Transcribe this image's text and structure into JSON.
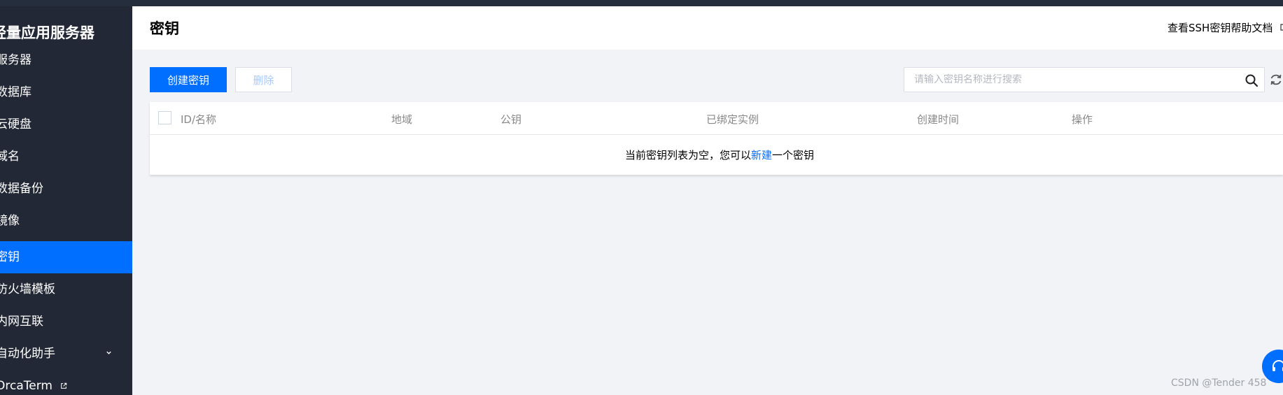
{
  "sidebar": {
    "brand": "轻量应用服务器",
    "items": [
      {
        "label": "服务器"
      },
      {
        "label": "数据库"
      },
      {
        "label": "云硬盘"
      },
      {
        "label": "域名"
      },
      {
        "label": "数据备份"
      },
      {
        "label": "镜像"
      },
      {
        "label": "密钥",
        "active": true
      },
      {
        "label": "防火墙模板"
      },
      {
        "label": "内网互联"
      },
      {
        "label": "自动化助手"
      },
      {
        "label": "OrcaTerm"
      }
    ]
  },
  "header": {
    "title": "密钥",
    "help_link": "查看SSH密钥帮助文档"
  },
  "toolbar": {
    "create_label": "创建密钥",
    "delete_label": "删除",
    "search_placeholder": "请输入密钥名称进行搜索"
  },
  "table": {
    "columns": [
      "ID/名称",
      "地域",
      "公钥",
      "已绑定实例",
      "创建时间",
      "操作"
    ],
    "empty": {
      "before": "当前密钥列表为空，您可以",
      "link": "新建",
      "after": "一个密钥"
    }
  },
  "watermark": "CSDN @Tender 458",
  "colors": {
    "accent": "#006eff",
    "sidebar_bg": "#222836",
    "page_bg": "#f2f3f7"
  }
}
